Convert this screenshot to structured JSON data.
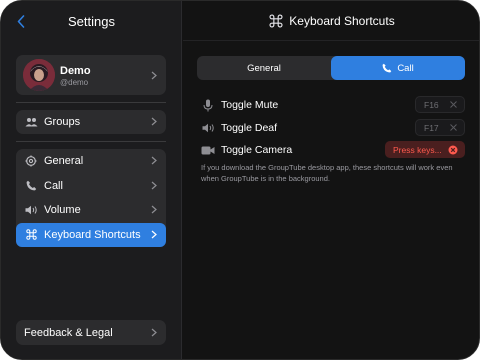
{
  "sidebar": {
    "title": "Settings",
    "profile": {
      "name": "Demo",
      "handle": "@demo"
    },
    "groups_label": "Groups",
    "items": [
      {
        "label": "General",
        "icon": "gear-icon"
      },
      {
        "label": "Call",
        "icon": "phone-icon"
      },
      {
        "label": "Volume",
        "icon": "speaker-icon"
      },
      {
        "label": "Keyboard Shortcuts",
        "icon": "command-icon",
        "active": true
      }
    ],
    "footer_label": "Feedback & Legal"
  },
  "main": {
    "title": "Keyboard Shortcuts",
    "tabs": [
      {
        "label": "General",
        "active": false
      },
      {
        "label": "Call",
        "active": true
      }
    ],
    "shortcuts": [
      {
        "label": "Toggle Mute",
        "key": "F16",
        "icon": "microphone-icon"
      },
      {
        "label": "Toggle Deaf",
        "key": "F17",
        "icon": "speaker-icon"
      },
      {
        "label": "Toggle Camera",
        "key": "Press keys...",
        "icon": "camera-icon",
        "recording": true
      }
    ],
    "note": "If you download the GroupTube desktop app, these shortcuts will work even when GroupTube is in the background."
  },
  "colors": {
    "accent": "#2f7fe0",
    "recording": "#ff5a4e",
    "recording_bg": "#4a1f1f"
  }
}
